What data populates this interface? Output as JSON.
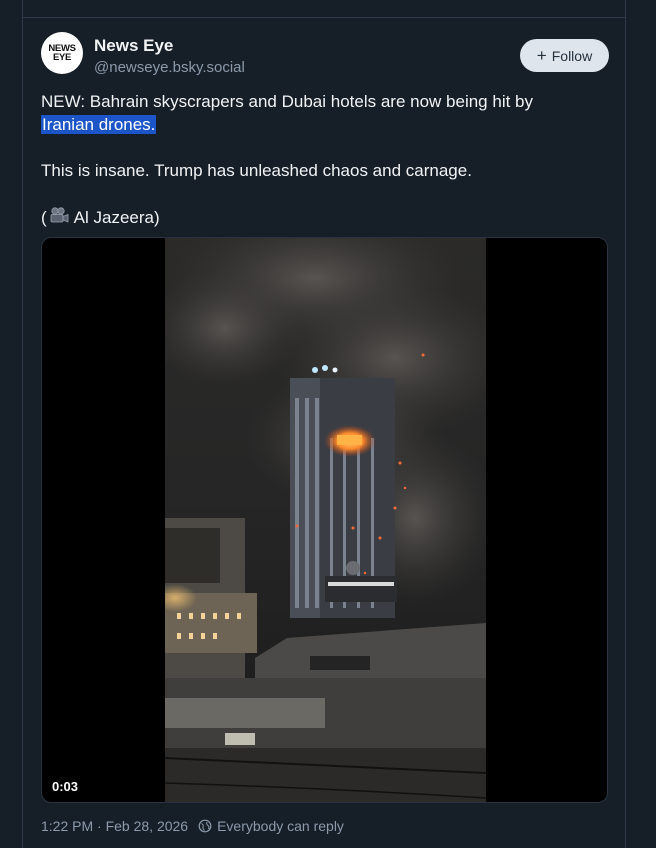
{
  "author": {
    "avatar_text_1": "NEWS",
    "avatar_text_2": "EYE",
    "display_name": "News Eye",
    "handle": "@newseye.bsky.social"
  },
  "follow_label": "Follow",
  "post": {
    "line1": "NEW: Bahrain skyscrapers and Dubai hotels are now being hit by",
    "line2_highlight": "Iranian drones.",
    "line3": "This is insane. Trump has unleashed chaos and carnage.",
    "line4_open": "(",
    "line4_source": "Al Jazeera)"
  },
  "video": {
    "timecode": "0:03"
  },
  "meta": {
    "timestamp": "1:22 PM · Feb 28, 2026",
    "reply_setting": "Everybody can reply"
  },
  "colors": {
    "background": "#161e27",
    "highlight": "#1b55c7",
    "muted": "#8c9aab"
  }
}
